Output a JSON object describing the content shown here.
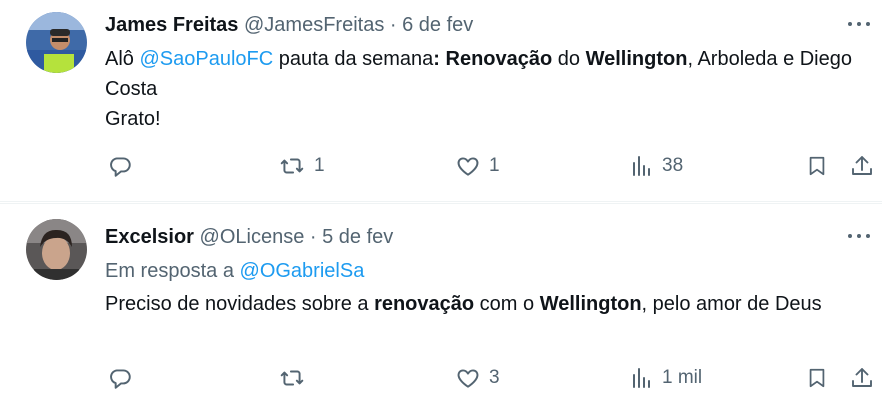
{
  "tweets": [
    {
      "name": "James Freitas",
      "handle": "@JamesFreitas",
      "sep": "·",
      "date": "6 de fev",
      "text_parts": {
        "p1": "Alô ",
        "mention": "@SaoPauloFC",
        "p2": " pauta da semana",
        "p3": ": ",
        "b1": "Renovação",
        "p4": " do ",
        "b2": "Wellington",
        "p5": ", Arboleda e Diego Costa",
        "line2": "Grato!"
      },
      "replies": "",
      "retweets": "1",
      "likes": "1",
      "views": "38"
    },
    {
      "name": "Excelsior",
      "handle": "@OLicense",
      "sep": "·",
      "date": "5 de fev",
      "reply_prefix": "Em resposta a ",
      "reply_mention": "@OGabrielSa",
      "text_parts": {
        "p1": "Preciso de novidades sobre a ",
        "b1": "renovação",
        "p2": " com o ",
        "b2": "Wellington",
        "p3": ", pelo amor de Deus"
      },
      "replies": "",
      "retweets": "",
      "likes": "3",
      "views": "1 mil"
    }
  ],
  "colors": {
    "accent": "#1d9bf0",
    "muted": "#536471",
    "text": "#0f1419",
    "border": "#eff3f4"
  },
  "icons": [
    "reply-icon",
    "retweet-icon",
    "like-icon",
    "views-icon",
    "bookmark-icon",
    "share-icon",
    "more-icon"
  ]
}
